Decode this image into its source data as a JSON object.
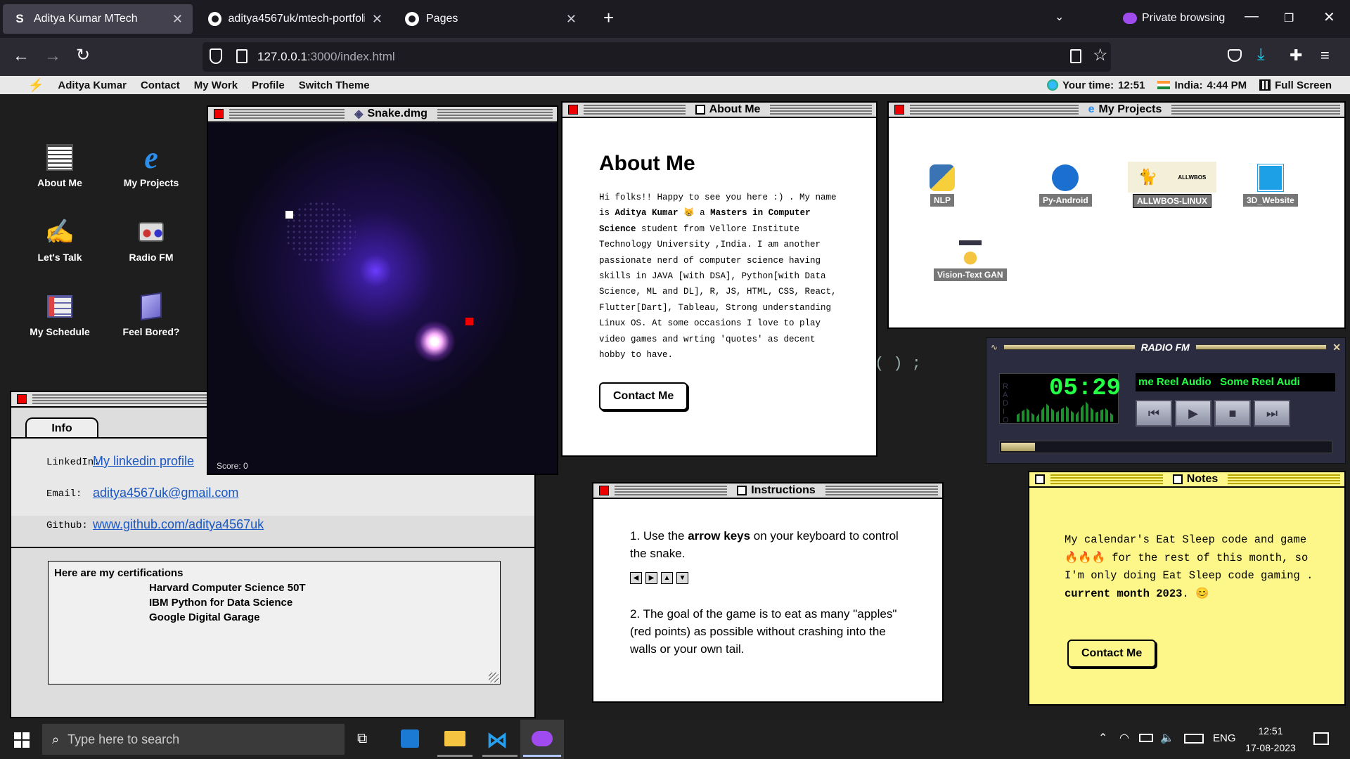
{
  "browser": {
    "tabs": [
      {
        "label": "Aditya Kumar MTech"
      },
      {
        "label": "aditya4567uk/mtech-portfolio-"
      },
      {
        "label": "Pages"
      }
    ],
    "private_label": "Private browsing",
    "url_host": "127.0.0.1",
    "url_rest": ":3000/index.html"
  },
  "menubar": {
    "logo": "Aditya Kumar",
    "items": [
      "Contact",
      "My Work",
      "Profile",
      "Switch Theme"
    ],
    "your_time_label": "Your time:",
    "your_time": "12:51",
    "india_label": "India:",
    "india_time": "4:44 PM",
    "fullscreen": "Full Screen"
  },
  "desktop_icons": [
    {
      "label": "About Me",
      "icon": "newspaper-icon"
    },
    {
      "label": "My Projects",
      "icon": "ie-icon"
    },
    {
      "label": "Let's Talk",
      "icon": "pen-icon"
    },
    {
      "label": "Radio FM",
      "icon": "radio-icon"
    },
    {
      "label": "My Schedule",
      "icon": "schedule-icon"
    },
    {
      "label": "Feel Bored?",
      "icon": "folder-icon"
    }
  ],
  "snake": {
    "title": "Snake.dmg",
    "score_label": "Score: 0"
  },
  "about": {
    "title": "About Me",
    "heading": "About Me",
    "p1": "Hi folks!! Happy to see you here :) . My name is ",
    "name": "Aditya Kumar",
    "p2": " a ",
    "degree": "Masters in Computer Science",
    "p3": " student from Vellore Institute Technology University ,India. I am another passionate nerd of computer science having skills in JAVA [with DSA], Python[with Data Science, ML and DL], R, JS, HTML, CSS, React, Flutter[Dart], Tableau, Strong understanding Linux OS. At some occasions I love to play video games and wrting 'quotes' as decent hobby to have.",
    "button": "Contact Me"
  },
  "projects": {
    "title": "My Projects",
    "items": [
      "NLP",
      "Py-Android",
      "ALLWBOS-LINUX",
      "3D_Website",
      "Vision-Text GAN"
    ],
    "allwbos_logo": "ALLWBOS"
  },
  "info": {
    "tab": "Info",
    "linkedin_label": "LinkedIn:",
    "linkedin": "My linkedin profile",
    "email_label": "Email:",
    "email": "aditya4567uk@gmail.com",
    "github_label": "Github:",
    "github": "www.github.com/aditya4567uk",
    "cert_heading": "Here are my certifications",
    "certs": [
      "Harvard Computer Science 50T",
      "IBM Python for Data Science",
      "Google Digital Garage"
    ]
  },
  "instructions": {
    "title": "Instructions",
    "s1_pre": "1. Use the ",
    "s1_bold": "arrow keys",
    "s1_post": " on your keyboard to control the snake.",
    "s2": "2. The goal of the game is to eat as many \"apples\" (red points) as possible without crashing into the walls or your own tail."
  },
  "radio": {
    "title": "RADIO FM",
    "time": "05:29",
    "marquee": "me Reel Audio   Some Reel Audi",
    "side": "RADIO"
  },
  "notes": {
    "title": "Notes",
    "text1": "My calendar's Eat Sleep code and game",
    "text2": " for the rest of this month, so I'm only doing Eat Sleep code gaming . ",
    "bold": "current month 2023",
    "text3": ". ",
    "button": "Contact Me"
  },
  "bg_code": "( ) ;",
  "taskbar": {
    "search": "Type here to search",
    "lang": "ENG",
    "time": "12:51",
    "date": "17-08-2023"
  },
  "colors": {
    "accent_red": "#ee0000",
    "notes_yellow": "#fdf78a",
    "radio_green": "#22ff44",
    "link": "#1a56c4"
  }
}
